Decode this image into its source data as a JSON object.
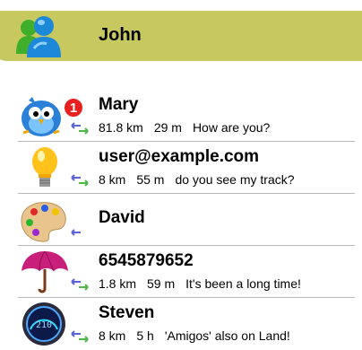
{
  "header": {
    "user_name": "John",
    "avatar_icon": "messenger-buddy-icon",
    "colors": {
      "bar": "#c8c860"
    }
  },
  "contacts": [
    {
      "name": "Mary",
      "icon": "bird-icon",
      "badge": "1",
      "distance": "81.8 km",
      "time": "29 m",
      "message": "How are you?"
    },
    {
      "name": "user@example.com",
      "icon": "lightbulb-icon",
      "distance": "8 km",
      "time": "55 m",
      "message": "do you see my track?"
    },
    {
      "name": "David",
      "icon": "paint-palette-icon"
    },
    {
      "name": "6545879652",
      "icon": "umbrella-icon",
      "distance": "1.8 km",
      "time": "59 m",
      "message": "It's been a long time!"
    },
    {
      "name": "Steven",
      "icon": "gauge-icon",
      "distance": "8 km",
      "time": "5 h",
      "message": "'Amigos' also on Land!"
    }
  ]
}
